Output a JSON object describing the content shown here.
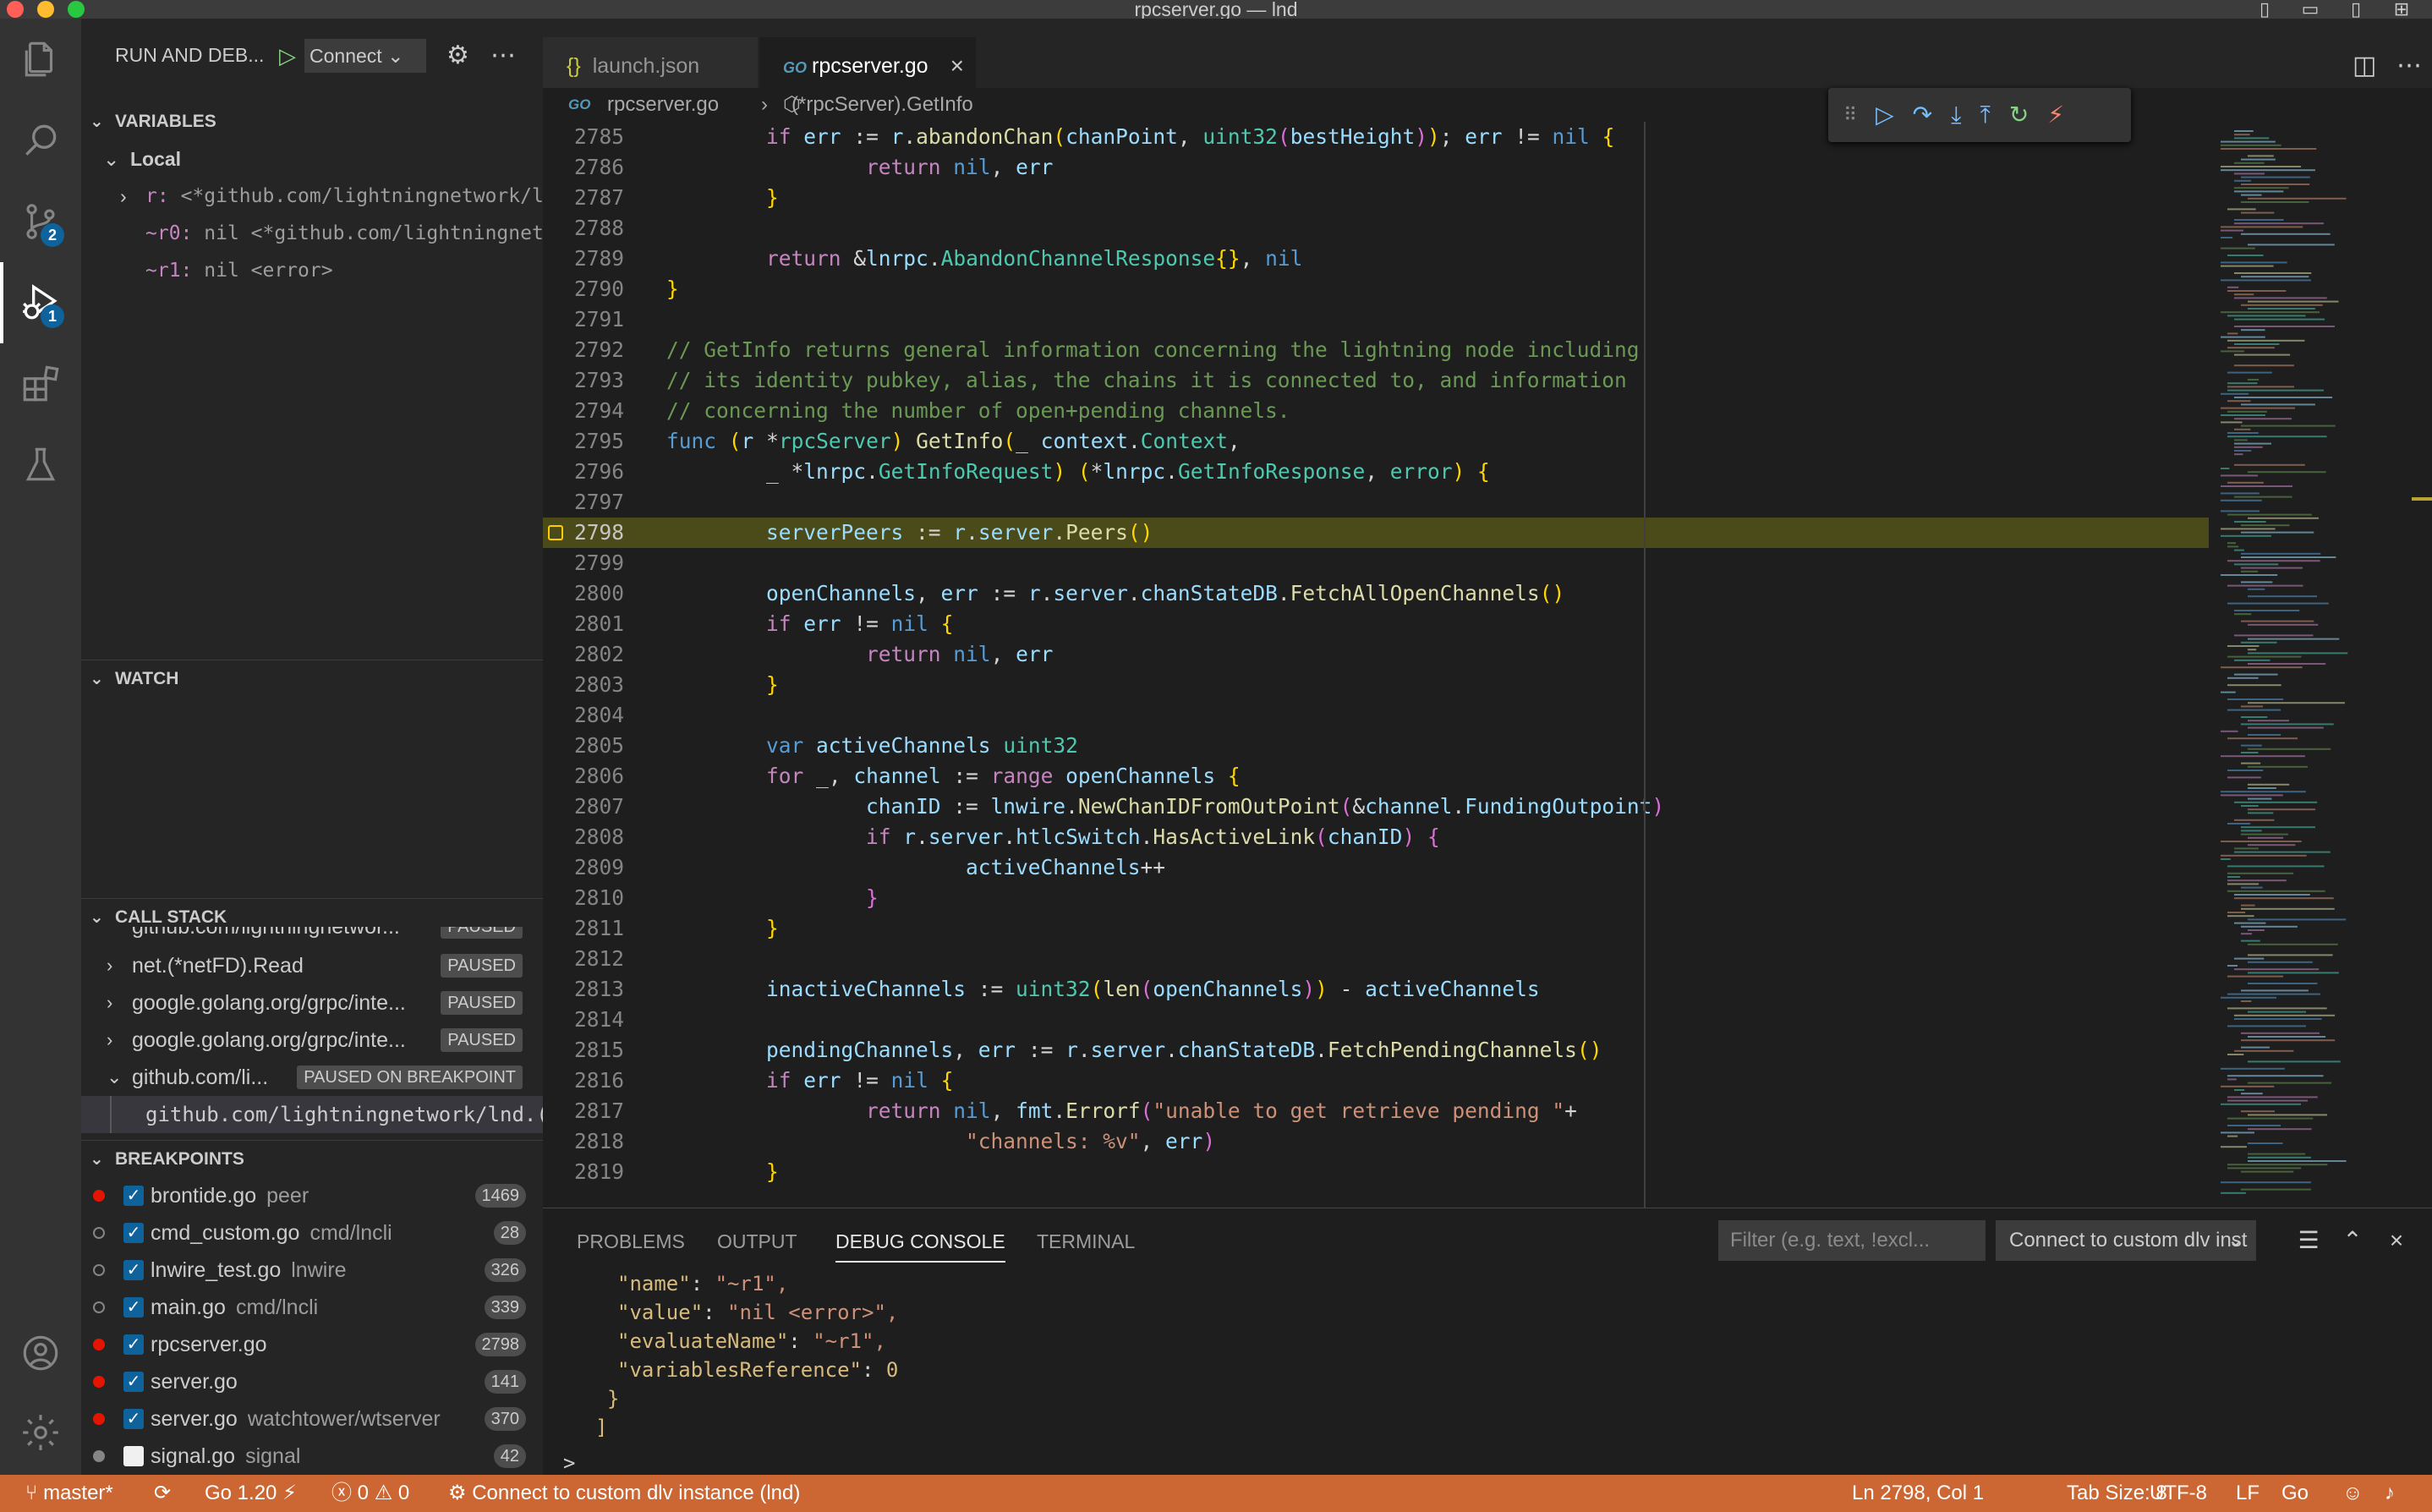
{
  "window": {
    "title": "rpcserver.go — lnd"
  },
  "colors": {
    "statusbar": "#cc6633",
    "accent": "#0e639c",
    "breakpoint": "#e51400",
    "current_line": "#4b4a19"
  },
  "activity_bar": {
    "items": [
      {
        "name": "explorer-icon"
      },
      {
        "name": "search-icon"
      },
      {
        "name": "source-control-icon",
        "badge": "2"
      },
      {
        "name": "run-and-debug-icon",
        "badge": "1"
      },
      {
        "name": "extensions-icon"
      },
      {
        "name": "testing-icon"
      }
    ],
    "bottom": [
      {
        "name": "accounts-icon"
      },
      {
        "name": "manage-gear-icon"
      }
    ]
  },
  "sidebar": {
    "title": "RUN AND DEB...",
    "launch_config": "Connect",
    "variables": {
      "header": "VARIABLES",
      "scope": "Local",
      "items": [
        {
          "name": "r:",
          "value": "<*github.com/lightningnetwork/l..."
        },
        {
          "name": "~r0:",
          "value": "nil <*github.com/lightningnet..."
        },
        {
          "name": "~r1:",
          "value": "nil <error>"
        }
      ]
    },
    "watch": {
      "header": "WATCH"
    },
    "call_stack": {
      "header": "CALL STACK",
      "items": [
        {
          "name": "github.com/lightningnetwor...",
          "state": "PAUSED"
        },
        {
          "name": "net.(*netFD).Read",
          "state": "PAUSED"
        },
        {
          "name": "google.golang.org/grpc/inte...",
          "state": "PAUSED"
        },
        {
          "name": "google.golang.org/grpc/inte...",
          "state": "PAUSED"
        },
        {
          "name": "github.com/li...",
          "state": "PAUSED ON BREAKPOINT"
        }
      ],
      "frame": "github.com/lightningnetwork/lnd.(*rp"
    },
    "breakpoints": {
      "header": "BREAKPOINTS",
      "items": [
        {
          "file": "brontide.go",
          "path": "peer",
          "line": "1469",
          "enabled": true,
          "active": true
        },
        {
          "file": "cmd_custom.go",
          "path": "cmd/lncli",
          "line": "28",
          "enabled": true,
          "active": false
        },
        {
          "file": "lnwire_test.go",
          "path": "lnwire",
          "line": "326",
          "enabled": true,
          "active": false
        },
        {
          "file": "main.go",
          "path": "cmd/lncli",
          "line": "339",
          "enabled": true,
          "active": false
        },
        {
          "file": "rpcserver.go",
          "path": "",
          "line": "2798",
          "enabled": true,
          "active": true
        },
        {
          "file": "server.go",
          "path": "",
          "line": "141",
          "enabled": true,
          "active": true
        },
        {
          "file": "server.go",
          "path": "watchtower/wtserver",
          "line": "370",
          "enabled": true,
          "active": true
        },
        {
          "file": "signal.go",
          "path": "signal",
          "line": "42",
          "enabled": false,
          "active": false
        }
      ]
    }
  },
  "tabs": [
    {
      "label": "launch.json",
      "icon": "{}"
    },
    {
      "label": "rpcserver.go",
      "icon": "GO"
    }
  ],
  "breadcrumb": {
    "file": "rpcserver.go",
    "symbol": "(*rpcServer).GetInfo"
  },
  "editor": {
    "lines": [
      {
        "n": "2785",
        "html": "        <span class=\"k\">if</span> <span class=\"v\">err</span> := <span class=\"v\">r</span>.<span class=\"f\">abandonChan</span><span class=\"b\">(</span><span class=\"v\">chanPoint</span>, <span class=\"t\">uint32</span><span class=\"bp\">(</span><span class=\"v\">bestHeight</span><span class=\"bp\">)</span><span class=\"b\">)</span>; <span class=\"v\">err</span> != <span class=\"kw\">nil</span> <span class=\"b\">{</span>"
      },
      {
        "n": "2786",
        "html": "                <span class=\"k\">return</span> <span class=\"kw\">nil</span>, <span class=\"v\">err</span>"
      },
      {
        "n": "2787",
        "html": "        <span class=\"b\">}</span>"
      },
      {
        "n": "2788",
        "html": ""
      },
      {
        "n": "2789",
        "html": "        <span class=\"k\">return</span> &amp;<span class=\"v\">lnrpc</span>.<span class=\"t\">AbandonChannelResponse</span><span class=\"b\">{}</span>, <span class=\"kw\">nil</span>"
      },
      {
        "n": "2790",
        "html": "<span class=\"b\">}</span>"
      },
      {
        "n": "2791",
        "html": ""
      },
      {
        "n": "2792",
        "html": "<span class=\"c\">// GetInfo returns general information concerning the lightning node including</span>"
      },
      {
        "n": "2793",
        "html": "<span class=\"c\">// its identity pubkey, alias, the chains it is connected to, and information</span>"
      },
      {
        "n": "2794",
        "html": "<span class=\"c\">// concerning the number of open+pending channels.</span>"
      },
      {
        "n": "2795",
        "html": "<span class=\"kw\">func</span> <span class=\"b\">(</span><span class=\"v\">r</span> *<span class=\"t\">rpcServer</span><span class=\"b\">)</span> <span class=\"f\">GetInfo</span><span class=\"b\">(</span><span class=\"v\">_</span> <span class=\"v\">context</span>.<span class=\"t\">Context</span>,"
      },
      {
        "n": "2796",
        "html": "        <span class=\"v\">_</span> *<span class=\"v\">lnrpc</span>.<span class=\"t\">GetInfoRequest</span><span class=\"b\">)</span> <span class=\"b\">(</span>*<span class=\"v\">lnrpc</span>.<span class=\"t\">GetInfoResponse</span>, <span class=\"t\">error</span><span class=\"b\">)</span> <span class=\"b\">{</span>"
      },
      {
        "n": "2797",
        "html": ""
      },
      {
        "n": "2798",
        "html": "        <span class=\"v\">serverPeers</span> := <span class=\"v\">r</span>.<span class=\"v\">server</span>.<span class=\"f\">Peers</span><span class=\"b\">()</span>",
        "current": true
      },
      {
        "n": "2799",
        "html": ""
      },
      {
        "n": "2800",
        "html": "        <span class=\"v\">openChannels</span>, <span class=\"v\">err</span> := <span class=\"v\">r</span>.<span class=\"v\">server</span>.<span class=\"v\">chanStateDB</span>.<span class=\"f\">FetchAllOpenChannels</span><span class=\"b\">()</span>"
      },
      {
        "n": "2801",
        "html": "        <span class=\"k\">if</span> <span class=\"v\">err</span> != <span class=\"kw\">nil</span> <span class=\"b\">{</span>"
      },
      {
        "n": "2802",
        "html": "                <span class=\"k\">return</span> <span class=\"kw\">nil</span>, <span class=\"v\">err</span>"
      },
      {
        "n": "2803",
        "html": "        <span class=\"b\">}</span>"
      },
      {
        "n": "2804",
        "html": ""
      },
      {
        "n": "2805",
        "html": "        <span class=\"kw\">var</span> <span class=\"v\">activeChannels</span> <span class=\"t\">uint32</span>"
      },
      {
        "n": "2806",
        "html": "        <span class=\"k\">for</span> <span class=\"v\">_</span>, <span class=\"v\">channel</span> := <span class=\"k\">range</span> <span class=\"v\">openChannels</span> <span class=\"b\">{</span>"
      },
      {
        "n": "2807",
        "html": "                <span class=\"v\">chanID</span> := <span class=\"v\">lnwire</span>.<span class=\"f\">NewChanIDFromOutPoint</span><span class=\"bp\">(</span>&amp;<span class=\"v\">channel</span>.<span class=\"v\">FundingOutpoint</span><span class=\"bp\">)</span>"
      },
      {
        "n": "2808",
        "html": "                <span class=\"k\">if</span> <span class=\"v\">r</span>.<span class=\"v\">server</span>.<span class=\"v\">htlcSwitch</span>.<span class=\"f\">HasActiveLink</span><span class=\"bp\">(</span><span class=\"v\">chanID</span><span class=\"bp\">)</span> <span class=\"bp\">{</span>"
      },
      {
        "n": "2809",
        "html": "                        <span class=\"v\">activeChannels</span>++"
      },
      {
        "n": "2810",
        "html": "                <span class=\"bp\">}</span>"
      },
      {
        "n": "2811",
        "html": "        <span class=\"b\">}</span>"
      },
      {
        "n": "2812",
        "html": ""
      },
      {
        "n": "2813",
        "html": "        <span class=\"v\">inactiveChannels</span> := <span class=\"t\">uint32</span><span class=\"b\">(</span><span class=\"f\">len</span><span class=\"bp\">(</span><span class=\"v\">openChannels</span><span class=\"bp\">)</span><span class=\"b\">)</span> - <span class=\"v\">activeChannels</span>"
      },
      {
        "n": "2814",
        "html": ""
      },
      {
        "n": "2815",
        "html": "        <span class=\"v\">pendingChannels</span>, <span class=\"v\">err</span> := <span class=\"v\">r</span>.<span class=\"v\">server</span>.<span class=\"v\">chanStateDB</span>.<span class=\"f\">FetchPendingChannels</span><span class=\"b\">()</span>"
      },
      {
        "n": "2816",
        "html": "        <span class=\"k\">if</span> <span class=\"v\">err</span> != <span class=\"kw\">nil</span> <span class=\"b\">{</span>"
      },
      {
        "n": "2817",
        "html": "                <span class=\"k\">return</span> <span class=\"kw\">nil</span>, <span class=\"v\">fmt</span>.<span class=\"f\">Errorf</span><span class=\"bp\">(</span><span class=\"s\">\"unable to get retrieve pending \"</span>+"
      },
      {
        "n": "2818",
        "html": "                        <span class=\"s\">\"channels: %v\"</span>, <span class=\"v\">err</span><span class=\"bp\">)</span>"
      },
      {
        "n": "2819",
        "html": "        <span class=\"b\">}</span>"
      }
    ]
  },
  "panel": {
    "tabs": [
      "PROBLEMS",
      "OUTPUT",
      "DEBUG CONSOLE",
      "TERMINAL"
    ],
    "active_tab": "DEBUG CONSOLE",
    "filter_placeholder": "Filter (e.g. text, !excl...",
    "session": "Connect to custom dlv inst",
    "console": [
      {
        "indent": 1,
        "key": "\"name\"",
        "value": "\"~r1\","
      },
      {
        "indent": 1,
        "key": "\"value\"",
        "value": "\"nil <error>\","
      },
      {
        "indent": 1,
        "key": "\"evaluateName\"",
        "value": "\"~r1\","
      },
      {
        "indent": 1,
        "key": "\"variablesReference\"",
        "value": "0"
      }
    ],
    "close_brace": "}",
    "close_bracket": "]",
    "prompt": ">"
  },
  "statusbar": {
    "branch": "master*",
    "go_version": "Go 1.20",
    "errors": "0",
    "warnings": "0",
    "debug_session": "Connect to custom dlv instance (lnd)",
    "cursor": "Ln 2798, Col 1",
    "tab_size": "Tab Size: 8",
    "encoding": "UTF-8",
    "eol": "LF",
    "language": "Go"
  }
}
